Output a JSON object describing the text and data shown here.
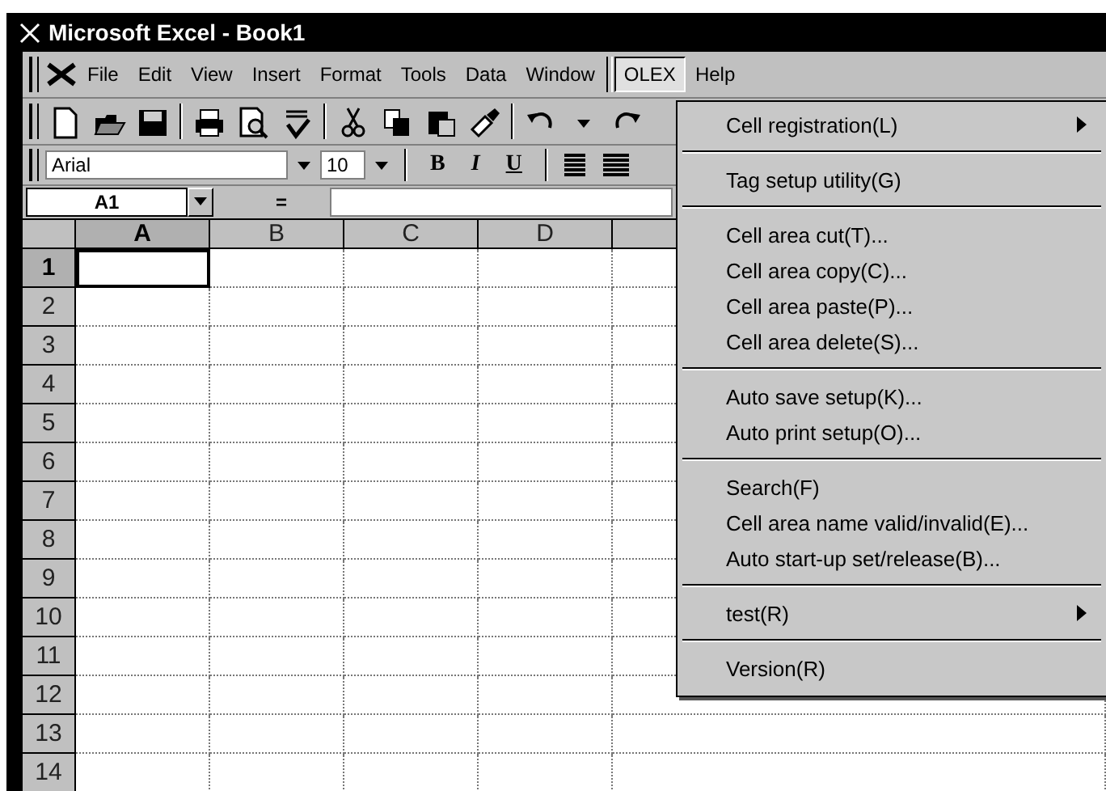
{
  "window": {
    "title": "Microsoft Excel - Book1"
  },
  "menu_bar": [
    {
      "label": "File",
      "selected": false
    },
    {
      "label": "Edit",
      "selected": false
    },
    {
      "label": "View",
      "selected": false
    },
    {
      "label": "Insert",
      "selected": false
    },
    {
      "label": "Format",
      "selected": false
    },
    {
      "label": "Tools",
      "selected": false
    },
    {
      "label": "Data",
      "selected": false
    },
    {
      "label": "Window",
      "selected": false
    },
    {
      "label": "OLEX",
      "selected": true
    },
    {
      "label": "Help",
      "selected": false
    }
  ],
  "formatting": {
    "font": "Arial",
    "size": "10",
    "style_buttons": [
      "B",
      "I",
      "U"
    ]
  },
  "formula_bar": {
    "name_box": "A1",
    "equals": "="
  },
  "sheet": {
    "columns": [
      {
        "label": "A",
        "selected": true
      },
      {
        "label": "B",
        "selected": false
      },
      {
        "label": "C",
        "selected": false
      },
      {
        "label": "D",
        "selected": false
      }
    ],
    "rows": [
      {
        "label": "1",
        "selected": true
      },
      {
        "label": "2",
        "selected": false
      },
      {
        "label": "3",
        "selected": false
      },
      {
        "label": "4",
        "selected": false
      },
      {
        "label": "5",
        "selected": false
      },
      {
        "label": "6",
        "selected": false
      },
      {
        "label": "7",
        "selected": false
      },
      {
        "label": "8",
        "selected": false
      },
      {
        "label": "9",
        "selected": false
      },
      {
        "label": "10",
        "selected": false
      },
      {
        "label": "11",
        "selected": false
      },
      {
        "label": "12",
        "selected": false
      },
      {
        "label": "13",
        "selected": false
      },
      {
        "label": "14",
        "selected": false
      }
    ]
  },
  "dropdown": {
    "groups": [
      [
        {
          "label": "Cell registration(L)",
          "submenu": true
        }
      ],
      [
        {
          "label": "Tag setup utility(G)",
          "submenu": false
        }
      ],
      [
        {
          "label": "Cell area cut(T)...",
          "submenu": false
        },
        {
          "label": "Cell area copy(C)...",
          "submenu": false
        },
        {
          "label": "Cell area paste(P)...",
          "submenu": false
        },
        {
          "label": "Cell area delete(S)...",
          "submenu": false
        }
      ],
      [
        {
          "label": "Auto save setup(K)...",
          "submenu": false
        },
        {
          "label": "Auto print setup(O)...",
          "submenu": false
        }
      ],
      [
        {
          "label": "Search(F)",
          "submenu": false
        },
        {
          "label": "Cell area name valid/invalid(E)...",
          "submenu": false
        },
        {
          "label": "Auto start-up set/release(B)...",
          "submenu": false
        }
      ],
      [
        {
          "label": "test(R)",
          "submenu": true
        }
      ],
      [
        {
          "label": "Version(R)",
          "submenu": false
        }
      ]
    ]
  }
}
